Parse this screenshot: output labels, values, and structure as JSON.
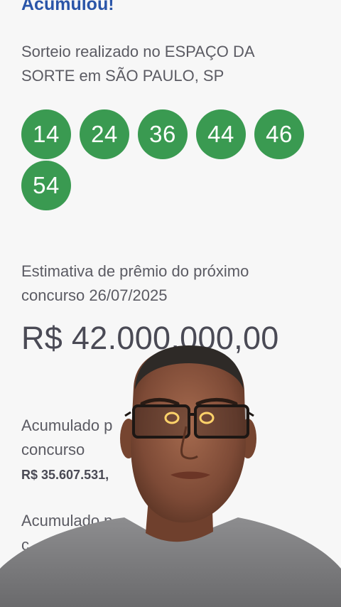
{
  "headline": "Acumulou!",
  "draw_info": "Sorteio realizado no ESPAÇO DA SORTE em SÃO PAULO, SP",
  "numbers": [
    "14",
    "24",
    "36",
    "44",
    "46",
    "54"
  ],
  "estimate": {
    "label": "Estimativa de prêmio do próximo concurso 26/07/2025",
    "value": "R$ 42.000.000,00"
  },
  "accumulated_1": {
    "label": "Acumulado p",
    "label_line2": "concurso",
    "value": "R$ 35.607.531,"
  },
  "accumulated_2": {
    "label": "Acumulado p",
    "label_line2": "c"
  },
  "colors": {
    "ball_green": "#3a9a51",
    "headline_blue": "#2a55a8",
    "background": "#f7f7f7"
  }
}
